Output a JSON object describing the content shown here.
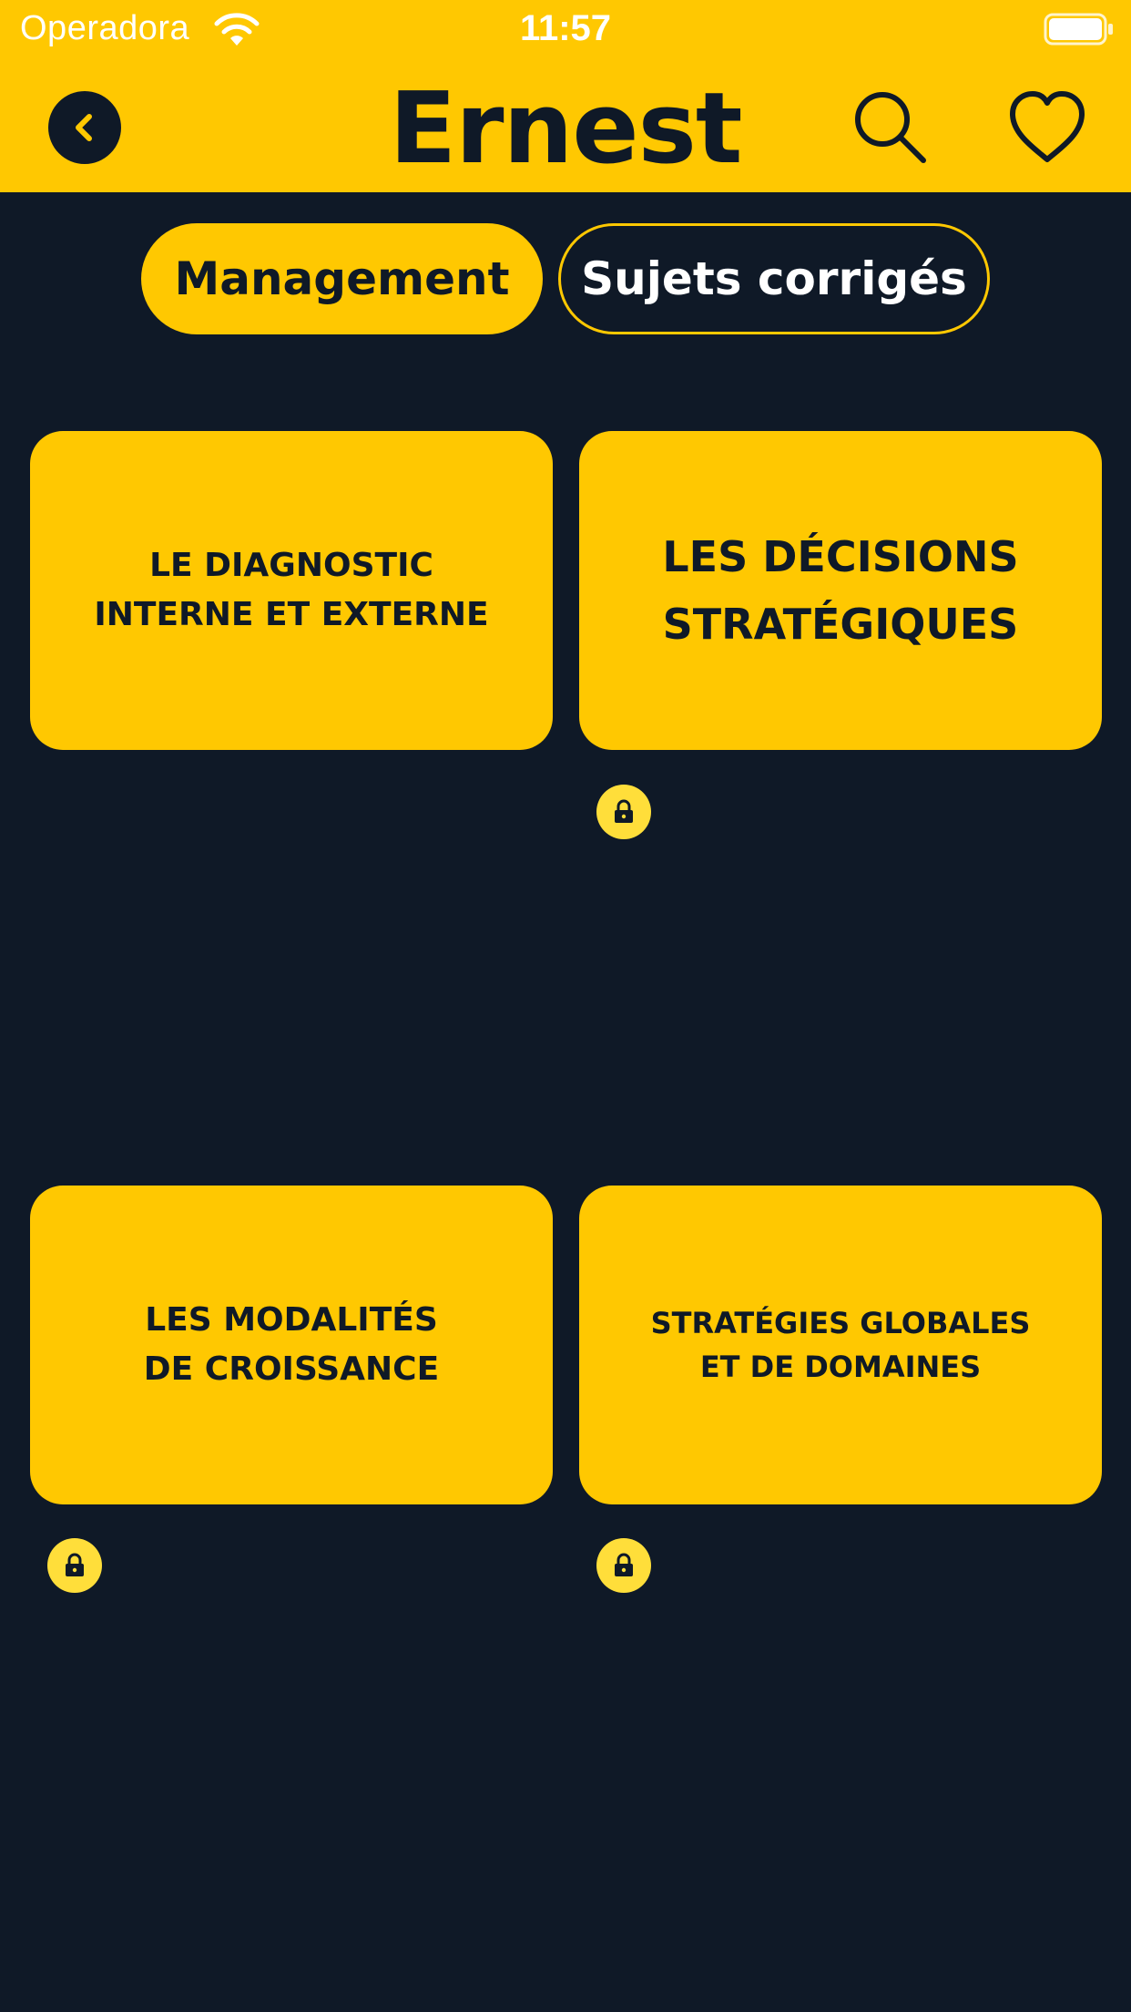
{
  "status_bar": {
    "carrier": "Operadora",
    "time": "11:57",
    "wifi_icon": "wifi-icon",
    "battery_icon": "battery-full-icon"
  },
  "header": {
    "title": "Ernest",
    "back_icon": "chevron-left-icon",
    "search_icon": "search-icon",
    "favorite_icon": "heart-icon"
  },
  "tabs": [
    {
      "label": "Management",
      "selected": true
    },
    {
      "label": "Sujets corrigés",
      "selected": false
    }
  ],
  "cards": [
    {
      "label": "LE DIAGNOSTIC\nINTERNE ET EXTERNE",
      "locked": false
    },
    {
      "label": "LES DÉCISIONS\nSTRATÉGIQUES",
      "locked": true
    },
    {
      "label": "LES MODALITÉS\nDE CROISSANCE",
      "locked": true
    },
    {
      "label": "STRATÉGIES GLOBALES\nET DE DOMAINES",
      "locked": true
    }
  ],
  "colors": {
    "accent": "#ffc801",
    "background": "#0f1927",
    "lock_badge": "#ffde3a",
    "text_light": "#ffffff"
  }
}
